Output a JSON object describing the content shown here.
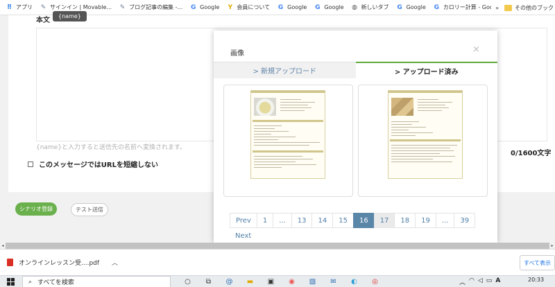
{
  "bookmarks": {
    "items": [
      {
        "icon": "apps-grid-icon",
        "label": "アプリ"
      },
      {
        "icon": "movable-type-icon",
        "label": "サインイン | Movable..."
      },
      {
        "icon": "blog-icon",
        "label": "ブログ記事の編集 -..."
      },
      {
        "icon": "google-icon",
        "label": "Google"
      },
      {
        "icon": "yahoo-icon",
        "label": "会員について"
      },
      {
        "icon": "google-icon",
        "label": "Google"
      },
      {
        "icon": "google-icon",
        "label": "Google"
      },
      {
        "icon": "globe-icon",
        "label": "新しいタブ"
      },
      {
        "icon": "google-icon",
        "label": "Google"
      },
      {
        "icon": "google-icon",
        "label": "カロリー計算 - Googl..."
      }
    ],
    "more": "»",
    "other_folder": "その他のブック"
  },
  "editor": {
    "section_label": "本文",
    "tooltip": "{name}",
    "char_count": "0/1600文字",
    "hint": "{name}と入力すると送信先の名前へ変換されます。",
    "shorten_url_label": "このメッセージではURLを短縮しない",
    "register_button": "シナリオ登録",
    "test_button": "テスト送信"
  },
  "modal": {
    "title": "画像",
    "close": "×",
    "tabs": [
      {
        "label": "> 新規アップロード",
        "active": false
      },
      {
        "label": "> アップロード済み",
        "active": true
      }
    ],
    "pagination": {
      "pages": [
        "Prev",
        "1",
        "...",
        "13",
        "14",
        "15",
        "16",
        "17",
        "18",
        "19",
        "...",
        "39"
      ],
      "current": "16",
      "next": "Next"
    }
  },
  "downloads": {
    "file": "オンラインレッスン受....pdf",
    "show_all": "すべて表示"
  },
  "taskbar": {
    "search_placeholder": "すべてを検索",
    "time": "20:33"
  }
}
